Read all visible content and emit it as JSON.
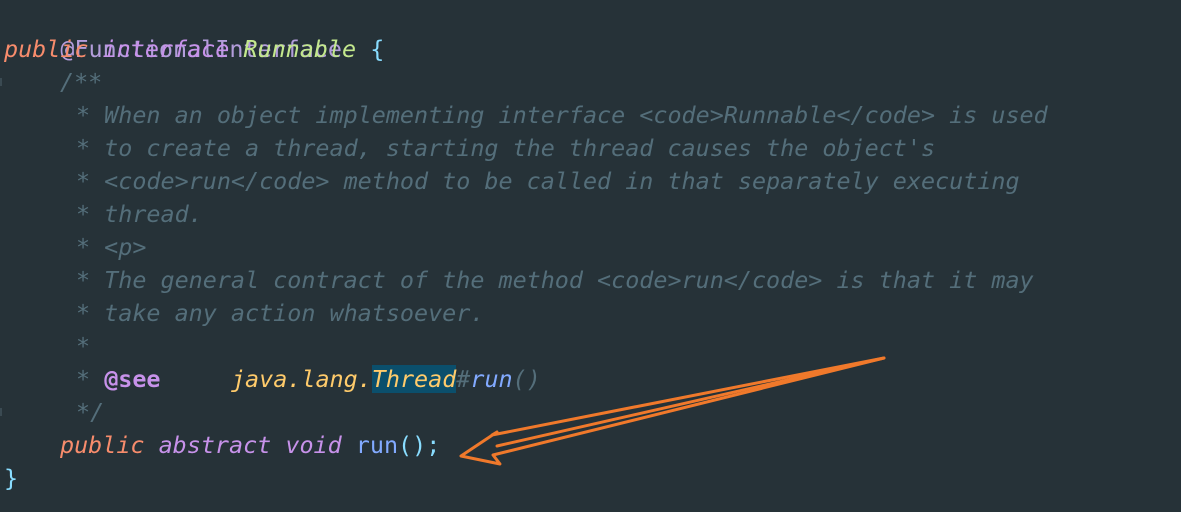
{
  "code": {
    "annotation": "@FunctionalInterface",
    "decl": {
      "kw_public": "public",
      "kw_interface": "interface",
      "name": "Runnable",
      "open_brace": "{"
    },
    "doc": {
      "open": "/**",
      "star": "*",
      "line1": " When an object implementing interface <code>Runnable</code> is used",
      "line2": " to create a thread, starting the thread causes the object's",
      "line3": " <code>run</code> method to be called in that separately executing",
      "line4": " thread.",
      "line5": " <p>",
      "line6": " The general contract of the method <code>run</code> is that it may",
      "line7": " take any action whatsoever.",
      "line8": "",
      "see_tag": "@see",
      "see_pkg": "java.lang.",
      "see_class": "Thread",
      "see_hash": "#",
      "see_method": "run",
      "see_parens": "()",
      "close": "*/"
    },
    "method_decl": {
      "kw_public": "public",
      "kw_abstract": "abstract",
      "kw_void": "void",
      "name": "run",
      "parens": "()",
      "semicolon": ";"
    },
    "close_brace": "}"
  },
  "theme": {
    "background": "#263238",
    "arrow_color": "#f0792b"
  }
}
